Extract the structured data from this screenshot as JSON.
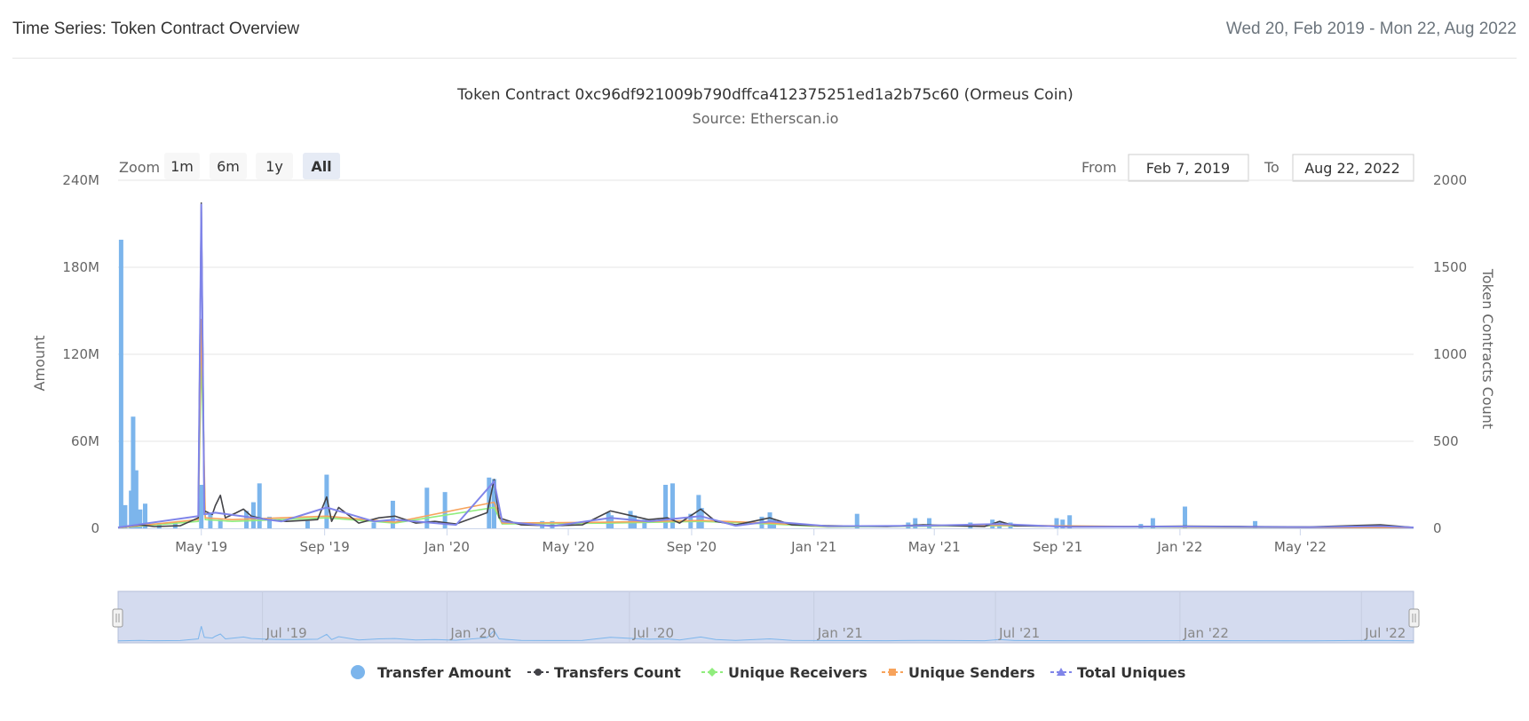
{
  "header": {
    "title": "Time Series: Token Contract Overview",
    "date_range": "Wed 20, Feb 2019 - Mon 22, Aug 2022"
  },
  "chart": {
    "title": "Token Contract 0xc96df921009b790dffca412375251ed1a2b75c60 (Ormeus Coin)",
    "subtitle": "Source: Etherscan.io",
    "zoom_label": "Zoom",
    "zoom_buttons": [
      "1m",
      "6m",
      "1y",
      "All"
    ],
    "zoom_selected": "All",
    "from_label": "From",
    "from_value": "Feb 7, 2019",
    "to_label": "To",
    "to_value": "Aug 22, 2022",
    "navigator_labels": [
      "Jul '19",
      "Jan '20",
      "Jul '20",
      "Jan '21",
      "Jul '21",
      "Jan '22",
      "Jul '22"
    ]
  },
  "colors": {
    "transfer_amount": "#7cb5ec",
    "transfers_count": "#434348",
    "unique_receivers": "#90ed7d",
    "unique_senders": "#f7a35c",
    "total_uniques": "#8085e9",
    "zoom_selected_bg": "#e6ebf5",
    "navigator_fill": "#d4dbef"
  },
  "chart_data": {
    "type": "bar",
    "title": "Token Contract 0xc96df921009b790dffca412375251ed1a2b75c60 (Ormeus Coin)",
    "subtitle": "Source: Etherscan.io",
    "x_range": [
      "2019-02-07",
      "2022-08-22"
    ],
    "x_tick_labels": [
      "May '19",
      "Sep '19",
      "Jan '20",
      "May '20",
      "Sep '20",
      "Jan '21",
      "May '21",
      "Sep '21",
      "Jan '22",
      "May '22"
    ],
    "x_tick_dates": [
      "2019-05-01",
      "2019-09-01",
      "2020-01-01",
      "2020-05-01",
      "2020-09-01",
      "2021-01-01",
      "2021-05-01",
      "2021-09-01",
      "2022-01-01",
      "2022-05-01"
    ],
    "y_left": {
      "label": "Amount",
      "ticks": [
        0,
        60000000,
        120000000,
        180000000,
        240000000
      ],
      "tick_labels": [
        "0",
        "60M",
        "120M",
        "180M",
        "240M"
      ],
      "range": [
        0,
        240000000
      ]
    },
    "y_right": {
      "label": "Token Contracts Count",
      "ticks": [
        0,
        500,
        1000,
        1500,
        2000
      ],
      "tick_labels": [
        "0",
        "500",
        "1000",
        "1500",
        "2000"
      ],
      "range": [
        0,
        2000
      ]
    },
    "grid": true,
    "legend_position": "bottom-center",
    "legend": [
      "Transfer Amount",
      "Transfers Count",
      "Unique Receivers",
      "Unique Senders",
      "Total Uniques"
    ],
    "series": [
      {
        "name": "Transfer Amount",
        "kind": "column",
        "axis": "left",
        "points": [
          [
            "2019-02-10",
            199000000
          ],
          [
            "2019-02-14",
            16000000
          ],
          [
            "2019-02-20",
            26000000
          ],
          [
            "2019-02-22",
            77000000
          ],
          [
            "2019-02-25",
            40000000
          ],
          [
            "2019-03-01",
            13000000
          ],
          [
            "2019-03-06",
            17000000
          ],
          [
            "2019-03-20",
            3000000
          ],
          [
            "2019-04-05",
            4000000
          ],
          [
            "2019-05-01",
            30000000
          ],
          [
            "2019-05-10",
            10000000
          ],
          [
            "2019-05-20",
            6000000
          ],
          [
            "2019-06-15",
            12000000
          ],
          [
            "2019-06-22",
            18000000
          ],
          [
            "2019-06-28",
            31000000
          ],
          [
            "2019-07-08",
            8000000
          ],
          [
            "2019-08-15",
            5000000
          ],
          [
            "2019-09-03",
            37000000
          ],
          [
            "2019-10-20",
            4000000
          ],
          [
            "2019-11-08",
            19000000
          ],
          [
            "2019-12-12",
            28000000
          ],
          [
            "2019-12-30",
            25000000
          ],
          [
            "2020-02-12",
            35000000
          ],
          [
            "2020-02-17",
            34000000
          ],
          [
            "2020-04-05",
            5000000
          ],
          [
            "2020-04-15",
            5000000
          ],
          [
            "2020-06-10",
            11000000
          ],
          [
            "2020-06-13",
            9000000
          ],
          [
            "2020-07-02",
            12000000
          ],
          [
            "2020-07-06",
            9000000
          ],
          [
            "2020-07-16",
            6000000
          ],
          [
            "2020-08-06",
            30000000
          ],
          [
            "2020-08-13",
            31000000
          ],
          [
            "2020-08-31",
            10000000
          ],
          [
            "2020-09-08",
            23000000
          ],
          [
            "2020-09-11",
            14000000
          ],
          [
            "2020-11-10",
            8000000
          ],
          [
            "2020-11-18",
            11000000
          ],
          [
            "2020-11-22",
            6000000
          ],
          [
            "2021-02-13",
            10000000
          ],
          [
            "2021-04-05",
            4000000
          ],
          [
            "2021-04-12",
            7000000
          ],
          [
            "2021-04-26",
            7000000
          ],
          [
            "2021-06-06",
            4000000
          ],
          [
            "2021-06-28",
            6000000
          ],
          [
            "2021-07-05",
            5000000
          ],
          [
            "2021-07-16",
            4000000
          ],
          [
            "2021-08-31",
            7000000
          ],
          [
            "2021-09-06",
            6000000
          ],
          [
            "2021-09-13",
            9000000
          ],
          [
            "2021-11-23",
            3000000
          ],
          [
            "2021-12-05",
            7000000
          ],
          [
            "2022-01-06",
            15000000
          ],
          [
            "2022-03-17",
            5000000
          ],
          [
            "2022-07-20",
            2000000
          ]
        ]
      },
      {
        "name": "Transfers Count",
        "kind": "line",
        "axis": "right",
        "points": [
          [
            "2019-02-07",
            5
          ],
          [
            "2019-03-01",
            20
          ],
          [
            "2019-03-15",
            10
          ],
          [
            "2019-04-10",
            15
          ],
          [
            "2019-04-28",
            60
          ],
          [
            "2019-05-01",
            1870
          ],
          [
            "2019-05-04",
            100
          ],
          [
            "2019-05-12",
            80
          ],
          [
            "2019-05-15",
            130
          ],
          [
            "2019-05-20",
            190
          ],
          [
            "2019-05-25",
            60
          ],
          [
            "2019-06-05",
            90
          ],
          [
            "2019-06-12",
            110
          ],
          [
            "2019-06-20",
            70
          ],
          [
            "2019-07-05",
            50
          ],
          [
            "2019-07-25",
            40
          ],
          [
            "2019-08-10",
            45
          ],
          [
            "2019-08-25",
            50
          ],
          [
            "2019-09-03",
            180
          ],
          [
            "2019-09-08",
            40
          ],
          [
            "2019-09-15",
            120
          ],
          [
            "2019-10-05",
            30
          ],
          [
            "2019-10-25",
            60
          ],
          [
            "2019-11-10",
            70
          ],
          [
            "2019-12-01",
            30
          ],
          [
            "2019-12-20",
            40
          ],
          [
            "2020-01-10",
            25
          ],
          [
            "2020-02-10",
            90
          ],
          [
            "2020-02-17",
            280
          ],
          [
            "2020-02-22",
            60
          ],
          [
            "2020-03-15",
            20
          ],
          [
            "2020-04-15",
            15
          ],
          [
            "2020-05-15",
            20
          ],
          [
            "2020-06-12",
            100
          ],
          [
            "2020-07-05",
            70
          ],
          [
            "2020-07-20",
            50
          ],
          [
            "2020-08-08",
            60
          ],
          [
            "2020-08-20",
            30
          ],
          [
            "2020-09-10",
            110
          ],
          [
            "2020-09-25",
            40
          ],
          [
            "2020-10-15",
            20
          ],
          [
            "2020-11-18",
            60
          ],
          [
            "2020-12-10",
            20
          ],
          [
            "2021-01-15",
            15
          ],
          [
            "2021-02-15",
            12
          ],
          [
            "2021-03-15",
            10
          ],
          [
            "2021-04-20",
            20
          ],
          [
            "2021-05-20",
            15
          ],
          [
            "2021-06-20",
            10
          ],
          [
            "2021-07-05",
            40
          ],
          [
            "2021-07-20",
            15
          ],
          [
            "2021-09-10",
            10
          ],
          [
            "2021-11-10",
            10
          ],
          [
            "2022-01-06",
            12
          ],
          [
            "2022-03-10",
            10
          ],
          [
            "2022-05-10",
            8
          ],
          [
            "2022-07-20",
            20
          ],
          [
            "2022-08-22",
            5
          ]
        ]
      },
      {
        "name": "Unique Receivers",
        "kind": "line",
        "axis": "right",
        "points": [
          [
            "2019-02-07",
            3
          ],
          [
            "2019-04-28",
            40
          ],
          [
            "2019-05-01",
            1000
          ],
          [
            "2019-05-05",
            50
          ],
          [
            "2019-06-01",
            40
          ],
          [
            "2019-09-03",
            60
          ],
          [
            "2019-11-10",
            30
          ],
          [
            "2020-02-17",
            120
          ],
          [
            "2020-02-25",
            25
          ],
          [
            "2020-06-12",
            30
          ],
          [
            "2020-09-10",
            40
          ],
          [
            "2020-11-18",
            25
          ],
          [
            "2021-01-15",
            8
          ],
          [
            "2021-07-05",
            15
          ],
          [
            "2022-01-06",
            6
          ],
          [
            "2022-08-22",
            3
          ]
        ]
      },
      {
        "name": "Unique Senders",
        "kind": "line",
        "axis": "right",
        "points": [
          [
            "2019-02-07",
            3
          ],
          [
            "2019-04-28",
            50
          ],
          [
            "2019-05-01",
            1200
          ],
          [
            "2019-05-05",
            60
          ],
          [
            "2019-06-01",
            50
          ],
          [
            "2019-09-03",
            70
          ],
          [
            "2019-11-10",
            35
          ],
          [
            "2020-02-17",
            150
          ],
          [
            "2020-02-25",
            30
          ],
          [
            "2020-06-12",
            35
          ],
          [
            "2020-09-10",
            45
          ],
          [
            "2020-11-18",
            30
          ],
          [
            "2021-01-15",
            10
          ],
          [
            "2021-07-05",
            18
          ],
          [
            "2022-01-06",
            7
          ],
          [
            "2022-08-22",
            3
          ]
        ]
      },
      {
        "name": "Total Uniques",
        "kind": "line",
        "axis": "right",
        "points": [
          [
            "2019-02-07",
            5
          ],
          [
            "2019-04-28",
            70
          ],
          [
            "2019-05-01",
            1860
          ],
          [
            "2019-05-04",
            80
          ],
          [
            "2019-05-15",
            90
          ],
          [
            "2019-06-10",
            70
          ],
          [
            "2019-07-20",
            40
          ],
          [
            "2019-09-03",
            120
          ],
          [
            "2019-10-20",
            40
          ],
          [
            "2019-11-10",
            50
          ],
          [
            "2020-01-10",
            20
          ],
          [
            "2020-02-17",
            270
          ],
          [
            "2020-02-25",
            40
          ],
          [
            "2020-04-15",
            12
          ],
          [
            "2020-06-12",
            60
          ],
          [
            "2020-07-20",
            40
          ],
          [
            "2020-09-10",
            70
          ],
          [
            "2020-10-15",
            15
          ],
          [
            "2020-11-18",
            40
          ],
          [
            "2021-01-15",
            12
          ],
          [
            "2021-04-20",
            15
          ],
          [
            "2021-07-05",
            25
          ],
          [
            "2021-09-10",
            8
          ],
          [
            "2022-01-06",
            10
          ],
          [
            "2022-05-10",
            6
          ],
          [
            "2022-07-20",
            12
          ],
          [
            "2022-08-22",
            5
          ]
        ]
      }
    ]
  }
}
